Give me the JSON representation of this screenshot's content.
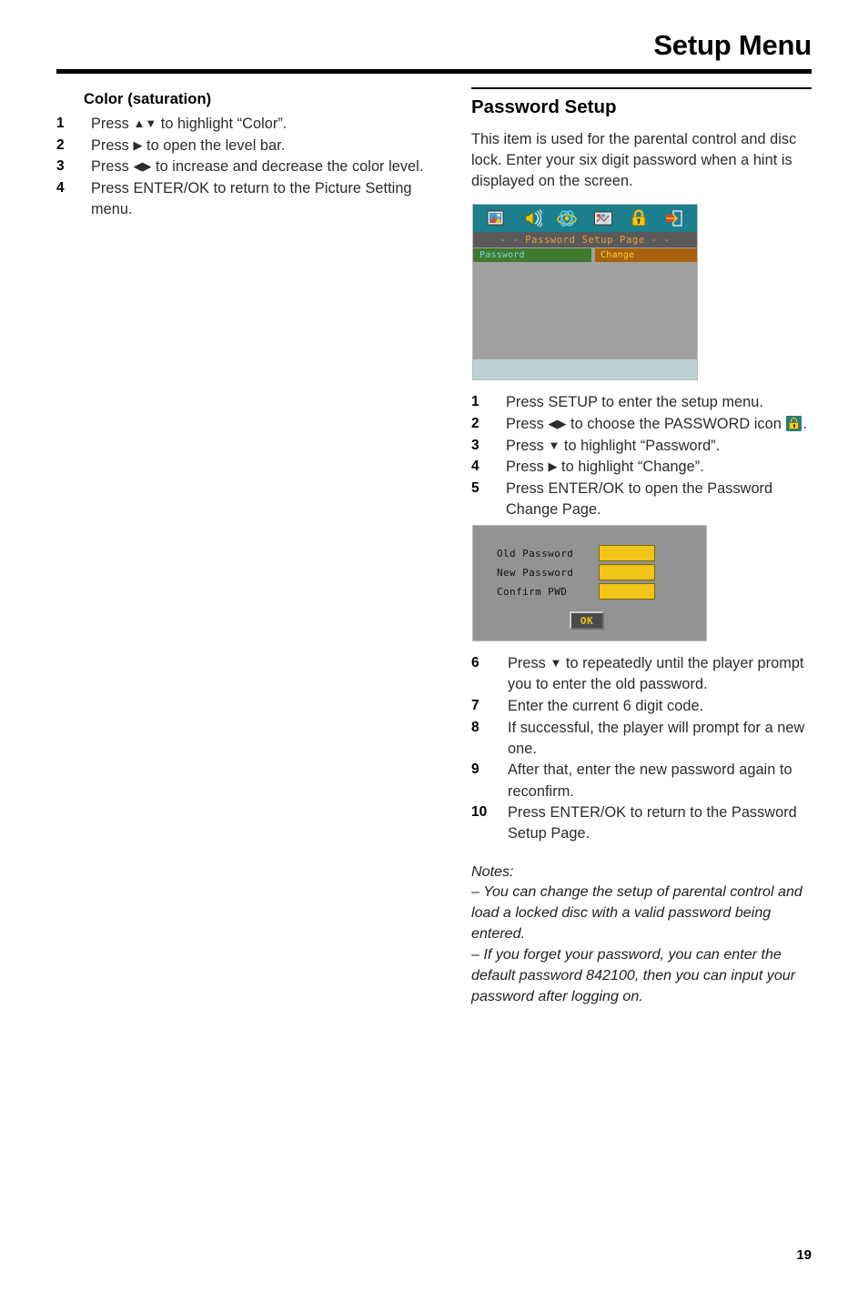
{
  "header": {
    "title": "Setup Menu"
  },
  "page_number": "19",
  "left_column": {
    "heading": "Color (saturation)",
    "steps": [
      {
        "num": "1",
        "text_before": "Press ",
        "arrows": "▲▼",
        "text_after": " to highlight “Color”."
      },
      {
        "num": "2",
        "text_before": "Press ",
        "arrows": "▶",
        "text_after": " to open the level bar."
      },
      {
        "num": "3",
        "text_before": "Press ",
        "arrows": "◀▶",
        "text_after": " to increase and decrease the color level."
      },
      {
        "num": "4",
        "text_before": "Press ENTER/OK to return to the Picture Setting menu.",
        "arrows": "",
        "text_after": ""
      }
    ]
  },
  "right_column": {
    "heading": "Password Setup",
    "intro": "This item is used for the parental control and disc lock. Enter your six digit password when a hint is displayed on the screen.",
    "osd_setup_page": {
      "icons": [
        "picture-icon",
        "audio-icon",
        "preference-icon",
        "video-icon",
        "password-lock-icon",
        "exit-icon"
      ],
      "title": "- -  Password  Setup  Page   - -",
      "row_label": "Password",
      "row_value": "Change",
      "colors": {
        "iconbar": "#1b7f8e",
        "titlebar": "#5a5a5a",
        "title_text": "#e8a03a",
        "label_cell": "#3f7a2e",
        "label_text": "#7fd8e8",
        "value_cell": "#a8620d",
        "value_text": "#ffd040",
        "body": "#a0a0a0",
        "footer_band": "#bcd2d2"
      }
    },
    "steps_a": [
      {
        "num": "1",
        "text_before": "Press SETUP to enter the setup menu.",
        "arrows": "",
        "text_after": ""
      },
      {
        "num": "2",
        "text_before": "Press ",
        "arrows": "◀▶",
        "text_after": " to choose the PASSWORD icon ",
        "icon": "password-lock-icon",
        "text_end": "."
      },
      {
        "num": "3",
        "text_before": "Press ",
        "arrows": "▼",
        "text_after": " to highlight “Password”."
      },
      {
        "num": "4",
        "text_before": "Press ",
        "arrows": "▶",
        "text_after": " to highlight “Change”."
      },
      {
        "num": "5",
        "text_before": "Press ENTER/OK to open the Password Change Page.",
        "arrows": "",
        "text_after": ""
      }
    ],
    "osd_change_page": {
      "fields": [
        {
          "label": "Old  Password",
          "value": ""
        },
        {
          "label": "New  Password",
          "value": ""
        },
        {
          "label": "Confirm  PWD",
          "value": ""
        }
      ],
      "ok_label": "OK",
      "colors": {
        "background": "#939393",
        "field_box": "#f0c518",
        "ok_bg": "#4a4a4a",
        "ok_text": "#f0c518"
      }
    },
    "steps_b": [
      {
        "num": "6",
        "text_before": "Press ",
        "arrows": "▼",
        "text_after": " to repeatedly until the player prompt you to enter the old password."
      },
      {
        "num": "7",
        "text_before": "Enter the current 6 digit code.",
        "arrows": "",
        "text_after": ""
      },
      {
        "num": "8",
        "text_before": "If successful, the player will prompt for a new one.",
        "arrows": "",
        "text_after": ""
      },
      {
        "num": "9",
        "text_before": "After that, enter the new password again to reconfirm.",
        "arrows": "",
        "text_after": ""
      },
      {
        "num": "10",
        "text_before": "Press ENTER/OK to return to the Password Setup Page.",
        "arrows": "",
        "text_after": ""
      }
    ],
    "notes": {
      "title": "Notes:",
      "items": [
        "–  You can change the setup of parental control and load a locked disc with a valid password being entered.",
        "–  If you forget your password, you can enter the default password 842100, then you can input your password after logging on."
      ]
    }
  }
}
